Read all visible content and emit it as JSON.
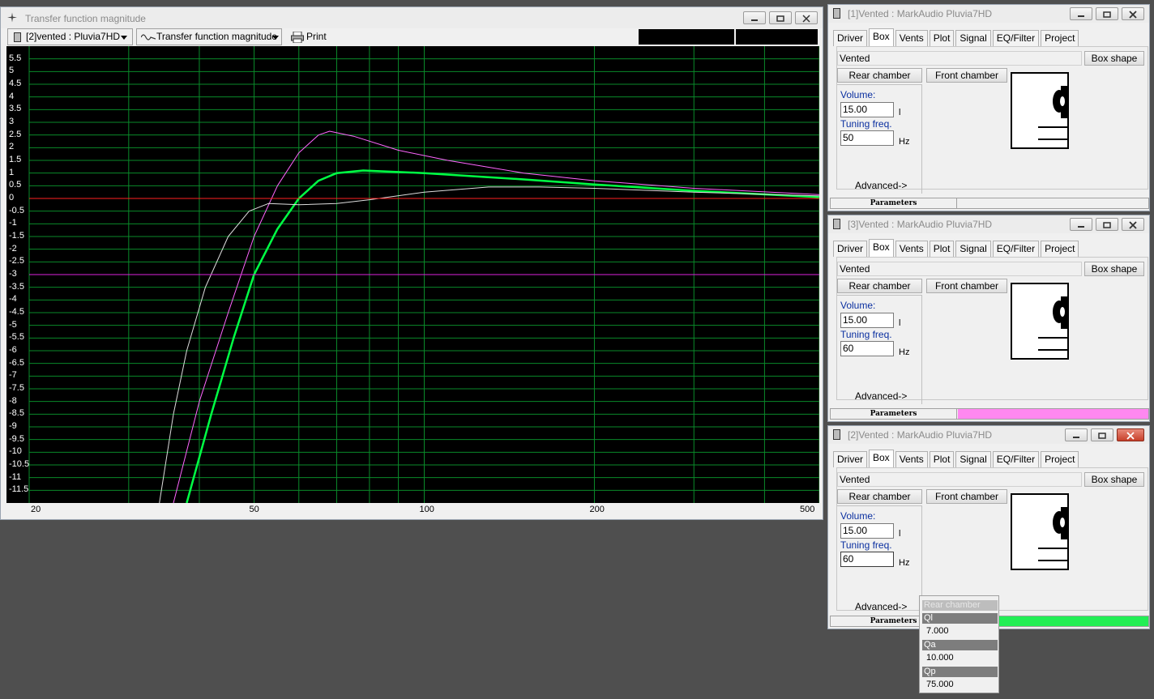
{
  "main_window": {
    "title": "Transfer function magnitude",
    "toolbar": {
      "project_select": "[2]vented : Pluvia7HD",
      "plot_select": "Transfer function magnitude",
      "print_label": "Print"
    },
    "plot": {
      "y_ticks": [
        "5.5",
        "5",
        "4.5",
        "4",
        "3.5",
        "3",
        "2.5",
        "2",
        "1.5",
        "1",
        "0.5",
        "0",
        "-0.5",
        "-1",
        "-1.5",
        "-2",
        "-2.5",
        "-3",
        "-3.5",
        "-4",
        "-4.5",
        "-5",
        "-5.5",
        "-6",
        "-6.5",
        "-7",
        "-7.5",
        "-8",
        "-8.5",
        "-9",
        "-9.5",
        "-10",
        "-10.5",
        "-11",
        "-11.5"
      ],
      "x_ticks": [
        "20",
        "50",
        "100",
        "200",
        "500"
      ]
    }
  },
  "chart_data": {
    "type": "line",
    "xscale": "log",
    "xlim": [
      20,
      500
    ],
    "ylim": [
      -12,
      6
    ],
    "grid": true,
    "xticks": [
      20,
      50,
      100,
      200,
      500
    ],
    "series": [
      {
        "color": "#ff66ff",
        "points": [
          [
            36,
            -12
          ],
          [
            40,
            -8
          ],
          [
            45,
            -4.5
          ],
          [
            50,
            -1.5
          ],
          [
            55,
            0.5
          ],
          [
            60,
            1.8
          ],
          [
            65,
            2.5
          ],
          [
            68,
            2.65
          ],
          [
            75,
            2.45
          ],
          [
            90,
            1.9
          ],
          [
            110,
            1.5
          ],
          [
            150,
            1.0
          ],
          [
            200,
            0.7
          ],
          [
            300,
            0.4
          ],
          [
            500,
            0.15
          ]
        ]
      },
      {
        "color": "#00ff44",
        "points": [
          [
            38,
            -12
          ],
          [
            42,
            -8.5
          ],
          [
            46,
            -5.5
          ],
          [
            50,
            -3.0
          ],
          [
            55,
            -1.2
          ],
          [
            60,
            0.0
          ],
          [
            65,
            0.7
          ],
          [
            70,
            1.0
          ],
          [
            78,
            1.1
          ],
          [
            100,
            1.0
          ],
          [
            150,
            0.75
          ],
          [
            200,
            0.55
          ],
          [
            300,
            0.3
          ],
          [
            500,
            0.05
          ]
        ]
      },
      {
        "color": "#dddddd",
        "points": [
          [
            34,
            -12
          ],
          [
            36,
            -8.5
          ],
          [
            38,
            -6.0
          ],
          [
            41,
            -3.5
          ],
          [
            45,
            -1.5
          ],
          [
            49,
            -0.5
          ],
          [
            53,
            -0.2
          ],
          [
            60,
            -0.25
          ],
          [
            70,
            -0.2
          ],
          [
            80,
            -0.05
          ],
          [
            100,
            0.25
          ],
          [
            130,
            0.45
          ],
          [
            160,
            0.45
          ],
          [
            200,
            0.4
          ],
          [
            300,
            0.25
          ],
          [
            500,
            0.1
          ]
        ]
      },
      {
        "color": "#ff2020",
        "points": [
          [
            20,
            0
          ],
          [
            500,
            0
          ]
        ]
      },
      {
        "color": "#dd22dd",
        "points": [
          [
            20,
            -3
          ],
          [
            500,
            -3
          ]
        ]
      }
    ]
  },
  "panels": [
    {
      "title": "[1]Vented : MarkAudio Pluvia7HD",
      "tabs": [
        "Driver",
        "Box",
        "Vents",
        "Plot",
        "Signal",
        "EQ/Filter",
        "Project"
      ],
      "alignment": "Vented",
      "box_shape": "Box shape",
      "rear": "Rear chamber",
      "front": "Front chamber",
      "volume_label": "Volume:",
      "volume": "15.00",
      "volume_unit": "l",
      "tuning_label": "Tuning freq.",
      "tuning": "50",
      "tuning_unit": "Hz",
      "advanced": "Advanced->",
      "parameters": "Parameters",
      "color": "#f0f0f0"
    },
    {
      "title": "[3]Vented : MarkAudio Pluvia7HD",
      "tabs": [
        "Driver",
        "Box",
        "Vents",
        "Plot",
        "Signal",
        "EQ/Filter",
        "Project"
      ],
      "alignment": "Vented",
      "box_shape": "Box shape",
      "rear": "Rear chamber",
      "front": "Front chamber",
      "volume_label": "Volume:",
      "volume": "15.00",
      "volume_unit": "l",
      "tuning_label": "Tuning freq.",
      "tuning": "60",
      "tuning_unit": "Hz",
      "advanced": "Advanced->",
      "parameters": "Parameters",
      "color": "#ff88f0"
    },
    {
      "title": "[2]Vented : MarkAudio Pluvia7HD",
      "tabs": [
        "Driver",
        "Box",
        "Vents",
        "Plot",
        "Signal",
        "EQ/Filter",
        "Project"
      ],
      "alignment": "Vented",
      "box_shape": "Box shape",
      "rear": "Rear chamber",
      "front": "Front chamber",
      "volume_label": "Volume:",
      "volume": "15.00",
      "volume_unit": "l",
      "tuning_label": "Tuning freq.",
      "tuning": "60",
      "tuning_unit": "Hz",
      "advanced": "Advanced->",
      "parameters": "Parameters",
      "color": "#22ee55"
    }
  ],
  "popup": {
    "header": "Rear chamber",
    "items": [
      {
        "label": "Ql",
        "value": "7.000"
      },
      {
        "label": "Qa",
        "value": "10.000"
      },
      {
        "label": "Qp",
        "value": "75.000"
      }
    ]
  }
}
